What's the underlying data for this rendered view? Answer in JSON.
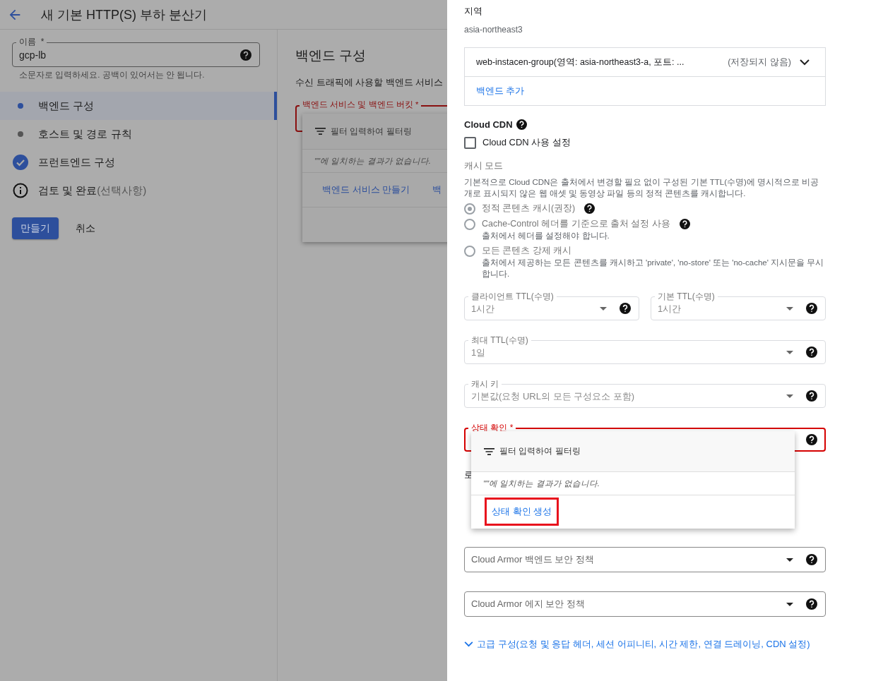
{
  "header": {
    "title": "새 기본 HTTP(S) 부하 분산기"
  },
  "name_field": {
    "label": "이름",
    "required_mark": "*",
    "value": "gcp-lb",
    "hint": "소문자로 입력하세요. 공백이 있어서는 안 됩니다."
  },
  "steps": [
    {
      "label": "백엔드 구성",
      "kind": "current",
      "selected": true
    },
    {
      "label": "호스트 및 경로 규칙",
      "kind": "pending",
      "selected": false
    },
    {
      "label": "프런트엔드 구성",
      "kind": "done",
      "selected": false
    },
    {
      "label": "검토 및 완료",
      "optional": "(선택사항)",
      "kind": "info",
      "selected": false
    }
  ],
  "actions": {
    "create": "만들기",
    "cancel": "취소"
  },
  "main": {
    "heading": "백엔드 구성",
    "description": "수신 트래픽에 사용할 백엔드 서비스",
    "select": {
      "label": "백엔드 서비스 및 백엔드 버킷 *",
      "error": true
    },
    "menu": {
      "filter_placeholder": "필터 입력하여 필터링",
      "no_results": "\"\"에 일치하는 결과가 없습니다.",
      "links": [
        "백엔드 서비스 만들기",
        "백"
      ]
    }
  },
  "panel": {
    "region_label": "지역",
    "region_value": "asia-northeast3",
    "backends": [
      {
        "name": "web-instacen-group(영역: asia-northeast3-a, 포트: ...",
        "status": "(저장되지 않음)"
      }
    ],
    "add_backend": "백엔드 추가",
    "cdn": {
      "title": "Cloud CDN",
      "checkbox": {
        "label": "Cloud CDN 사용 설정",
        "checked": false
      }
    },
    "cache_mode": {
      "label": "캐시 모드",
      "description": "기본적으로 Cloud CDN은 출처에서 변경할 필요 없이 구성된 기본 TTL(수명)에 명시적으로 비공개로 표시되지 않은 웹 애셋 및 동영상 파일 등의 정적 콘텐츠를 캐시합니다.",
      "options": [
        {
          "label": "정적 콘텐츠 캐시(권장)",
          "selected": true,
          "help": true
        },
        {
          "label": "Cache-Control 헤더를 기준으로 출처 설정 사용",
          "hint": "출처에서 헤더를 설정해야 합니다.",
          "selected": false,
          "help": true
        },
        {
          "label": "모든 콘텐츠 강제 캐시",
          "hint": "출처에서 제공하는 모든 콘텐츠를 캐시하고 'private', 'no-store' 또는 'no-cache' 지시문을 무시합니다.",
          "selected": false,
          "help": false
        }
      ]
    },
    "ttl_row": [
      {
        "label": "클라이언트 TTL(수명)",
        "value": "1시간"
      },
      {
        "label": "기본 TTL(수명)",
        "value": "1시간"
      }
    ],
    "selects": [
      {
        "label": "최대 TTL(수명)",
        "value": "1일"
      },
      {
        "label": "캐시 키",
        "value": "기본값(요청 URL의 모든 구성요소 포함)"
      }
    ],
    "health_check": {
      "label": "상태 확인 *",
      "error": true,
      "menu": {
        "filter_placeholder": "필터 입력하여 필터링",
        "no_results": "\"\"에 일치하는 결과가 없습니다.",
        "create_link": "상태 확인 생성",
        "highlighted": true
      }
    },
    "logging_label": "로",
    "security_selects": [
      {
        "placeholder": "Cloud Armor 백엔드 보안 정책"
      },
      {
        "placeholder": "Cloud Armor 에지 보안 정책"
      }
    ],
    "advanced": "고급 구성(요청 및 응답 헤더, 세션 어피니티, 시간 제한, 연결 드레이닝, CDN 설정)"
  }
}
